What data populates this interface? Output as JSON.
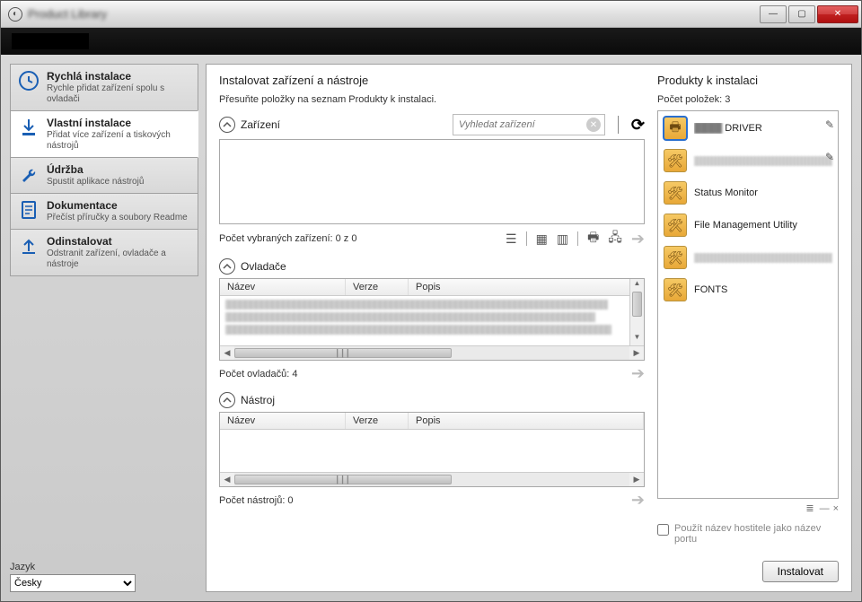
{
  "window": {
    "title": "Product Library"
  },
  "sidebar": {
    "items": [
      {
        "title": "Rychlá instalace",
        "desc": "Rychle přidat zařízení spolu s ovladači"
      },
      {
        "title": "Vlastní instalace",
        "desc": "Přidat více zařízení a tiskových nástrojů"
      },
      {
        "title": "Údržba",
        "desc": "Spustit aplikace nástrojů"
      },
      {
        "title": "Dokumentace",
        "desc": "Přečíst příručky a soubory Readme"
      },
      {
        "title": "Odinstalovat",
        "desc": "Odstranit zařízení, ovladače a nástroje"
      }
    ],
    "language_label": "Jazyk",
    "language_value": "Česky"
  },
  "main": {
    "title": "Instalovat zařízení a nástroje",
    "hint": "Přesuňte položky na seznam Produkty k instalaci.",
    "devices": {
      "label": "Zařízení",
      "search_placeholder": "Vyhledat zařízení",
      "footer": "Počet vybraných zařízení: 0 z 0"
    },
    "drivers": {
      "label": "Ovladače",
      "footer": "Počet ovladačů: 4",
      "columns": {
        "name": "Název",
        "version": "Verze",
        "desc": "Popis"
      }
    },
    "tools": {
      "label": "Nástroj",
      "footer": "Počet nástrojů: 0",
      "columns": {
        "name": "Název",
        "version": "Verze",
        "desc": "Popis"
      }
    }
  },
  "products": {
    "title": "Produkty k instalaci",
    "count_label": "Počet položek: 3",
    "items": [
      {
        "label": "DRIVER",
        "icon": "printer",
        "editable": true,
        "blurred_prefix": true
      },
      {
        "label": "",
        "icon": "tool",
        "editable": true,
        "blurred": true
      },
      {
        "label": "Status Monitor",
        "icon": "tool"
      },
      {
        "label": "File Management Utility",
        "icon": "tool"
      },
      {
        "label": "",
        "icon": "tool",
        "blurred": true,
        "short": true
      },
      {
        "label": "FONTS",
        "icon": "tool"
      }
    ],
    "hostname_checkbox": "Použít název hostitele jako název portu",
    "install_button": "Instalovat"
  }
}
